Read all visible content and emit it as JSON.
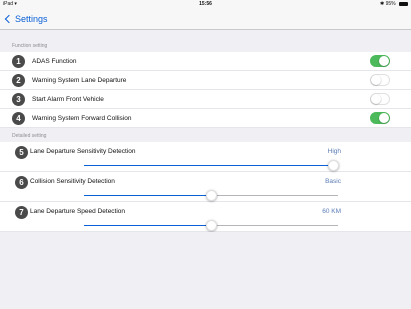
{
  "statusbar": {
    "device": "iPad",
    "wifi_icon": "wifi-icon",
    "time": "15:56",
    "bluetooth_icon": "bluetooth-icon",
    "battery": "95%"
  },
  "nav": {
    "back_label": "Settings"
  },
  "function_section": {
    "title": "Function setting",
    "items": [
      {
        "num": "1",
        "label": "ADAS Function",
        "on": true
      },
      {
        "num": "2",
        "label": "Warning System Lane Departure",
        "on": false
      },
      {
        "num": "3",
        "label": "Start Alarm Front Vehicle",
        "on": false
      },
      {
        "num": "4",
        "label": "Warning System Forward Collision",
        "on": true
      }
    ]
  },
  "detail_section": {
    "title": "Detailed setting",
    "items": [
      {
        "num": "5",
        "label": "Lane Departure Sensitivity Detection",
        "value": "High",
        "level_pct": 98
      },
      {
        "num": "6",
        "label": "Collision Sensitivity Detection",
        "value": "Basic",
        "level_pct": 50
      },
      {
        "num": "7",
        "label": "Lane Departure Speed Detection",
        "value": "60 KM",
        "level_pct": 50
      }
    ]
  },
  "colors": {
    "accent": "#0a60d6",
    "toggle_on": "#4cb95a",
    "badge": "#4a4a4a",
    "value_text": "#5a7bb5"
  }
}
